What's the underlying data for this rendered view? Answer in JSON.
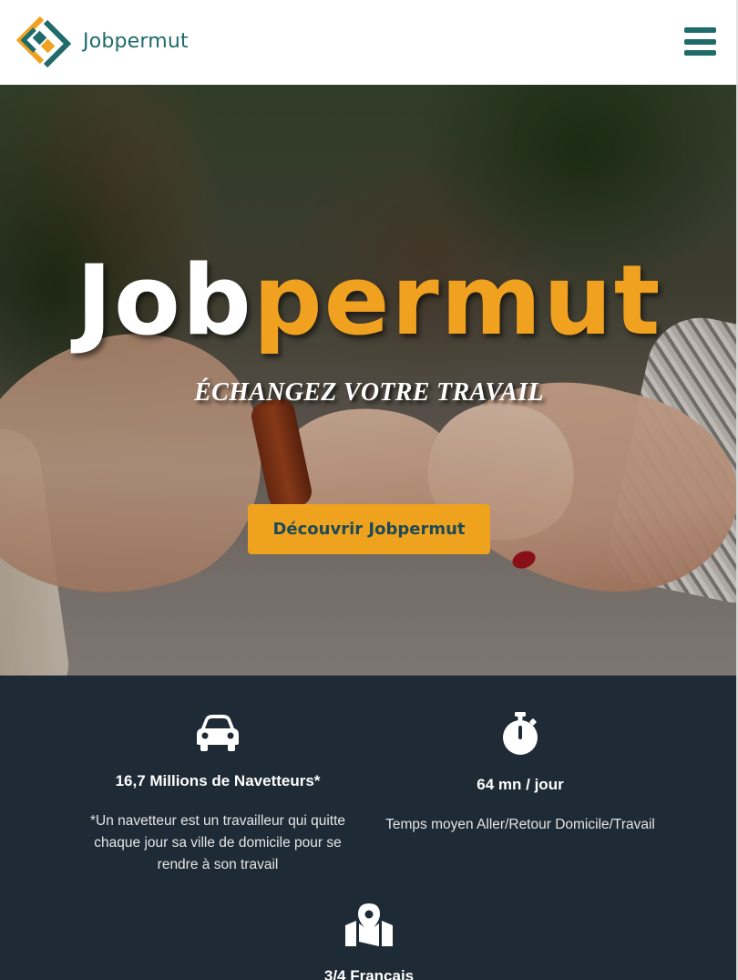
{
  "header": {
    "logo_text": "Jobpermut",
    "menu_icon": "hamburger-menu-icon",
    "colors": {
      "teal": "#1f6b6b",
      "orange": "#f0a11f"
    }
  },
  "hero": {
    "title_part1": "Job",
    "title_part2": "permut",
    "subtitle": "ÉCHANGEZ VOTRE TRAVAIL",
    "cta_label": "Découvrir Jobpermut",
    "cta_color": "#eea21e"
  },
  "stats": {
    "background": "#1e2a35",
    "items": [
      {
        "icon": "car-icon",
        "value": "16,7 Millions de Navetteurs*",
        "description": "*Un navetteur est un travailleur qui quitte chaque jour sa ville de domicile pour se rendre à son travail"
      },
      {
        "icon": "stopwatch-icon",
        "value": "64 mn / jour",
        "description": "Temps moyen Aller/Retour Domicile/Travail"
      },
      {
        "icon": "map-marker-icon",
        "value": "3/4 Francais"
      }
    ]
  }
}
